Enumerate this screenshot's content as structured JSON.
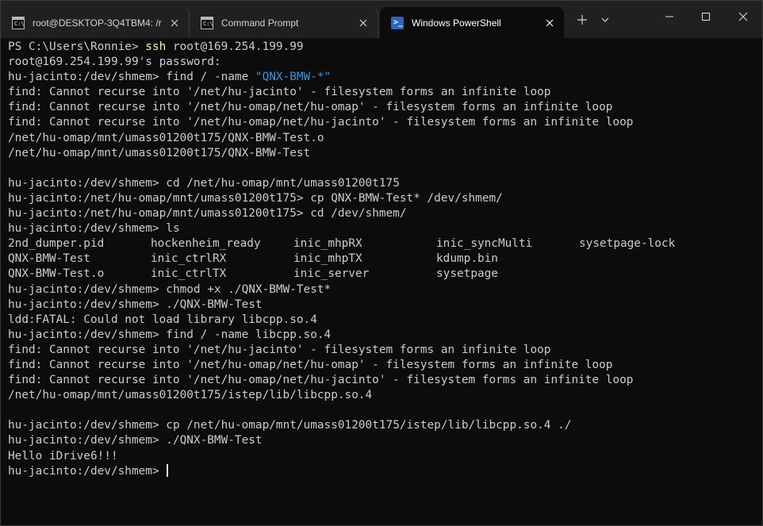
{
  "tabs": [
    {
      "label": "root@DESKTOP-3Q4TBM4: /r",
      "icon": "cmd-icon",
      "active": false
    },
    {
      "label": "Command Prompt",
      "icon": "cmd-icon",
      "active": false
    },
    {
      "label": "Windows PowerShell",
      "icon": "powershell-icon",
      "active": true
    }
  ],
  "icons": {
    "cmd_glyph": "C:\\",
    "ps_glyph": ">_"
  },
  "colors": {
    "background": "#0c0c0c",
    "tabbar": "#202020",
    "text": "#cccccc",
    "command": "#f9f1a5",
    "string": "#3a96dd"
  },
  "terminal": {
    "lines": [
      {
        "prompt": "PS C:\\Users\\Ronnie> ",
        "cmd": "ssh",
        "args": " root@169.254.199.99"
      },
      {
        "text": "root@169.254.199.99's password:"
      },
      {
        "prompt": "hu-jacinto:/dev/shmem> ",
        "text": "find / -name \"QNX-BMW-*\""
      },
      {
        "text": "find: Cannot recurse into '/net/hu-jacinto' - filesystem forms an infinite loop"
      },
      {
        "text": "find: Cannot recurse into '/net/hu-omap/net/hu-omap' - filesystem forms an infinite loop"
      },
      {
        "text": "find: Cannot recurse into '/net/hu-omap/net/hu-jacinto' - filesystem forms an infinite loop"
      },
      {
        "text": "/net/hu-omap/mnt/umass01200t175/QNX-BMW-Test.o"
      },
      {
        "text": "/net/hu-omap/mnt/umass01200t175/QNX-BMW-Test"
      },
      {
        "text": ""
      },
      {
        "prompt": "hu-jacinto:/dev/shmem> ",
        "text": "cd /net/hu-omap/mnt/umass01200t175"
      },
      {
        "prompt": "hu-jacinto:/net/hu-omap/mnt/umass01200t175> ",
        "text": "cp QNX-BMW-Test* /dev/shmem/"
      },
      {
        "prompt": "hu-jacinto:/net/hu-omap/mnt/umass01200t175> ",
        "text": "cd /dev/shmem/"
      },
      {
        "prompt": "hu-jacinto:/dev/shmem> ",
        "text": "ls"
      }
    ],
    "ls_rows": [
      [
        "2nd_dumper.pid",
        "hockenheim_ready",
        "inic_mhpRX",
        "inic_syncMulti",
        "sysetpage-lock"
      ],
      [
        "QNX-BMW-Test",
        "inic_ctrlRX",
        "inic_mhpTX",
        "kdump.bin",
        ""
      ],
      [
        "QNX-BMW-Test.o",
        "inic_ctrlTX",
        "inic_server",
        "sysetpage",
        ""
      ]
    ],
    "lines_after": [
      {
        "prompt": "hu-jacinto:/dev/shmem> ",
        "text": "chmod +x ./QNX-BMW-Test*"
      },
      {
        "prompt": "hu-jacinto:/dev/shmem> ",
        "text": "./QNX-BMW-Test"
      },
      {
        "text": "ldd:FATAL: Could not load library libcpp.so.4"
      },
      {
        "prompt": "hu-jacinto:/dev/shmem> ",
        "text": "find / -name libcpp.so.4"
      },
      {
        "text": "find: Cannot recurse into '/net/hu-jacinto' - filesystem forms an infinite loop"
      },
      {
        "text": "find: Cannot recurse into '/net/hu-omap/net/hu-omap' - filesystem forms an infinite loop"
      },
      {
        "text": "find: Cannot recurse into '/net/hu-omap/net/hu-jacinto' - filesystem forms an infinite loop"
      },
      {
        "text": "/net/hu-omap/mnt/umass01200t175/istep/lib/libcpp.so.4"
      },
      {
        "text": ""
      },
      {
        "prompt": "hu-jacinto:/dev/shmem> ",
        "text": "cp /net/hu-omap/mnt/umass01200t175/istep/lib/libcpp.so.4 ./"
      },
      {
        "prompt": "hu-jacinto:/dev/shmem> ",
        "text": "./QNX-BMW-Test"
      },
      {
        "text": "Hello iDrive6!!!"
      },
      {
        "prompt": "hu-jacinto:/dev/shmem> ",
        "text": "",
        "cursor": true
      }
    ]
  }
}
